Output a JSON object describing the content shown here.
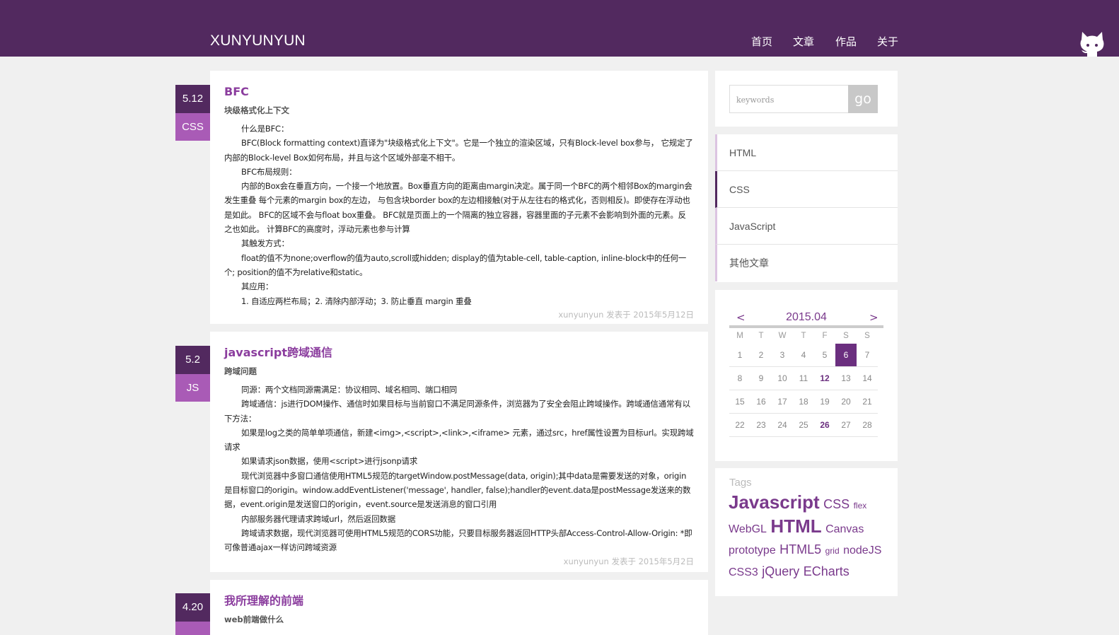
{
  "header": {
    "logo": "XUNYUNYUN",
    "nav": [
      {
        "label": "首页"
      },
      {
        "label": "文章"
      },
      {
        "label": "作品"
      },
      {
        "label": "关于"
      }
    ]
  },
  "posts": [
    {
      "date": "5.12",
      "category": "CSS",
      "title": "BFC",
      "subtitle": "块级格式化上下文",
      "paragraphs": [
        "什么是BFC：",
        "BFC(Block formatting context)直译为\"块级格式化上下文\"。它是一个独立的渲染区域，只有Block-level box参与， 它规定了内部的Block-level Box如何布局，并且与这个区域外部毫不相干。",
        "BFC布局规则：",
        "内部的Box会在垂直方向，一个接一个地放置。Box垂直方向的距离由margin决定。属于同一个BFC的两个相邻Box的margin会发生重叠 每个元素的margin box的左边， 与包含块border box的左边相接触(对于从左往右的格式化，否则相反)。即使存在浮动也是如此。 BFC的区域不会与float box重叠。 BFC就是页面上的一个隔离的独立容器，容器里面的子元素不会影响到外面的元素。反之也如此。 计算BFC的高度时，浮动元素也参与计算",
        "其触发方式：",
        "float的值不为none;overflow的值为auto,scroll或hidden; display的值为table-cell, table-caption, inline-block中的任何一个; position的值不为relative和static。",
        "其应用：",
        "1. 自适应两栏布局；2. 清除内部浮动；3. 防止垂直 margin 重叠"
      ],
      "footer": "xunyunyun 发表于 2015年5月12日"
    },
    {
      "date": "5.2",
      "category": "JS",
      "title": "javascript跨域通信",
      "subtitle": "跨域问题",
      "paragraphs": [
        "同源：两个文档同源需满足：协议相同、域名相同、端口相同",
        "跨域通信：js进行DOM操作、通信时如果目标与当前窗口不满足同源条件，浏览器为了安全会阻止跨域操作。跨域通信通常有以下方法：",
        "如果是log之类的简单单项通信，新建<img>,<script>,<link>,<iframe> 元素，通过src，href属性设置为目标url。实现跨域请求",
        "如果请求json数据，使用<script>进行jsonp请求",
        "现代浏览器中多窗口通信使用HTML5规范的targetWindow.postMessage(data, origin);其中data是需要发送的对象，origin是目标窗口的origin。window.addEventListener('message', handler, false);handler的event.data是postMessage发送来的数据，event.origin是发送窗口的origin，event.source是发送消息的窗口引用",
        "内部服务器代理请求跨域url，然后返回数据",
        "跨域请求数据，现代浏览器可使用HTML5规范的CORS功能，只要目标服务器返回HTTP头部Access-Control-Allow-Origin: *即可像普通ajax一样访问跨域资源"
      ],
      "footer": "xunyunyun 发表于 2015年5月2日"
    },
    {
      "date": "4.20",
      "category": "",
      "title": "我所理解的前端",
      "subtitle": "web前端做什么",
      "paragraphs": [],
      "footer": ""
    }
  ],
  "search": {
    "placeholder": "keywords",
    "button_label": "go"
  },
  "categories": [
    {
      "label": "HTML",
      "active": false
    },
    {
      "label": "CSS",
      "active": true
    },
    {
      "label": "JavaScript",
      "active": false
    },
    {
      "label": "其他文章",
      "active": false
    }
  ],
  "calendar": {
    "title": "2015.04",
    "prev": "<",
    "next": ">",
    "weekdays": [
      "M",
      "T",
      "W",
      "T",
      "F",
      "S",
      "S"
    ],
    "weeks": [
      [
        "1",
        "2",
        "3",
        "4",
        "5",
        "6",
        "7"
      ],
      [
        "8",
        "9",
        "10",
        "11",
        "12",
        "13",
        "14"
      ],
      [
        "15",
        "16",
        "17",
        "18",
        "19",
        "20",
        "21"
      ],
      [
        "22",
        "23",
        "24",
        "25",
        "26",
        "27",
        "28"
      ]
    ],
    "today": "6",
    "marked": [
      "12",
      "26"
    ]
  },
  "tags": {
    "title": "Tags",
    "items": [
      {
        "label": "Javascript",
        "weight": 5
      },
      {
        "label": "CSS",
        "weight": 3
      },
      {
        "label": "flex",
        "weight": 1
      },
      {
        "label": "WebGL",
        "weight": 2
      },
      {
        "label": "HTML",
        "weight": 5
      },
      {
        "label": "Canvas",
        "weight": 2
      },
      {
        "label": "prototype",
        "weight": 2
      },
      {
        "label": "HTML5",
        "weight": 3
      },
      {
        "label": "grid",
        "weight": 1
      },
      {
        "label": "nodeJS",
        "weight": 2
      },
      {
        "label": "CSS3",
        "weight": 2
      },
      {
        "label": "jQuery",
        "weight": 3
      },
      {
        "label": "ECharts",
        "weight": 3
      }
    ]
  },
  "colors": {
    "header": "#52295f",
    "accent": "#a95bb6",
    "title": "#8b3d9e"
  }
}
